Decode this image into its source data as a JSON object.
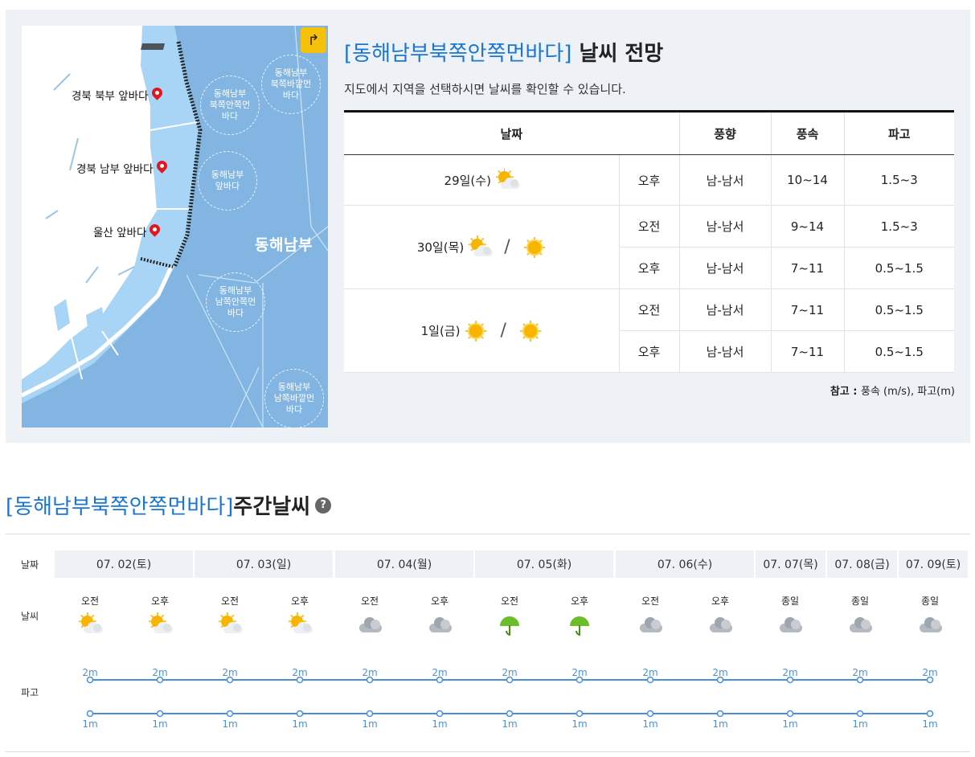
{
  "map": {
    "bubbles": [
      {
        "label": "동해남부\n북쪽안쪽먼\n바다"
      },
      {
        "label": "동해남부\n북쪽바깥먼\n바다"
      },
      {
        "label": "동해남부\n앞바다"
      },
      {
        "label": "동해남부\n남쪽안쪽먼\n바다"
      },
      {
        "label": "동해남부\n남쪽바깥먼\n바다"
      }
    ],
    "places": [
      {
        "label": "경북 북부 앞바다"
      },
      {
        "label": "경북 남부 앞바다"
      },
      {
        "label": "울산 앞바다"
      }
    ],
    "region_label": "동해남부",
    "reset_icon": "reset-arrow-icon"
  },
  "forecast": {
    "title_region": "[동해남부북쪽안쪽먼바다]",
    "title_suffix": " 날씨 전망",
    "subtitle": "지도에서 지역을 선택하시면 날씨를 확인할 수 있습니다.",
    "headers": {
      "date": "날짜",
      "wind_dir": "풍향",
      "wind_speed": "풍속",
      "wave": "파고"
    },
    "days": [
      {
        "date": "29일(수)",
        "icons": [
          "partly-cloudy-icon"
        ],
        "rows": [
          {
            "period": "오후",
            "wind_dir": "남-남서",
            "wind_speed": "10~14",
            "wave": "1.5~3"
          }
        ]
      },
      {
        "date": "30일(목)",
        "icons": [
          "partly-cloudy-icon",
          "sunny-icon"
        ],
        "rows": [
          {
            "period": "오전",
            "wind_dir": "남-남서",
            "wind_speed": "9~14",
            "wave": "1.5~3"
          },
          {
            "period": "오후",
            "wind_dir": "남-남서",
            "wind_speed": "7~11",
            "wave": "0.5~1.5"
          }
        ]
      },
      {
        "date": "1일(금)",
        "icons": [
          "sunny-icon",
          "sunny-icon"
        ],
        "rows": [
          {
            "period": "오전",
            "wind_dir": "남-남서",
            "wind_speed": "7~11",
            "wave": "0.5~1.5"
          },
          {
            "period": "오후",
            "wind_dir": "남-남서",
            "wind_speed": "7~11",
            "wave": "0.5~1.5"
          }
        ]
      }
    ],
    "note_prefix": "참고 : ",
    "note_text": "풍속 (m/s), 파고(m)"
  },
  "weekly": {
    "title_region": "[동해남부북쪽안쪽먼바다]",
    "title_suffix": " 주간날씨",
    "help_icon": "?",
    "row_labels": {
      "date": "날짜",
      "weather": "날씨",
      "wave": "파고"
    },
    "days": [
      {
        "date": "07. 02(토)",
        "slots": [
          {
            "period": "오전",
            "icon": "partly-cloudy-icon"
          },
          {
            "period": "오후",
            "icon": "partly-cloudy-icon"
          }
        ]
      },
      {
        "date": "07. 03(일)",
        "slots": [
          {
            "period": "오전",
            "icon": "partly-cloudy-icon"
          },
          {
            "period": "오후",
            "icon": "partly-cloudy-icon"
          }
        ]
      },
      {
        "date": "07. 04(월)",
        "slots": [
          {
            "period": "오전",
            "icon": "cloudy-icon"
          },
          {
            "period": "오후",
            "icon": "cloudy-icon"
          }
        ]
      },
      {
        "date": "07. 05(화)",
        "slots": [
          {
            "period": "오전",
            "icon": "umbrella-icon"
          },
          {
            "period": "오후",
            "icon": "umbrella-icon"
          }
        ]
      },
      {
        "date": "07. 06(수)",
        "slots": [
          {
            "period": "오전",
            "icon": "cloudy-icon"
          },
          {
            "period": "오후",
            "icon": "cloudy-icon"
          }
        ]
      },
      {
        "date": "07. 07(목)",
        "slots": [
          {
            "period": "종일",
            "icon": "cloudy-icon"
          }
        ]
      },
      {
        "date": "07. 08(금)",
        "slots": [
          {
            "period": "종일",
            "icon": "cloudy-icon"
          }
        ]
      },
      {
        "date": "07. 09(토)",
        "slots": [
          {
            "period": "종일",
            "icon": "cloudy-icon"
          }
        ]
      }
    ],
    "wave_max": [
      "2m",
      "2m",
      "2m",
      "2m",
      "2m",
      "2m",
      "2m",
      "2m",
      "2m",
      "2m",
      "2m",
      "2m",
      "2m"
    ],
    "wave_min": [
      "1m",
      "1m",
      "1m",
      "1m",
      "1m",
      "1m",
      "1m",
      "1m",
      "1m",
      "1m",
      "1m",
      "1m",
      "1m"
    ],
    "colors": {
      "accent": "#1976d2",
      "wave_line": "#4a90d9",
      "panel_bg": "#eef1f5",
      "sea": "#82b5e2"
    }
  }
}
